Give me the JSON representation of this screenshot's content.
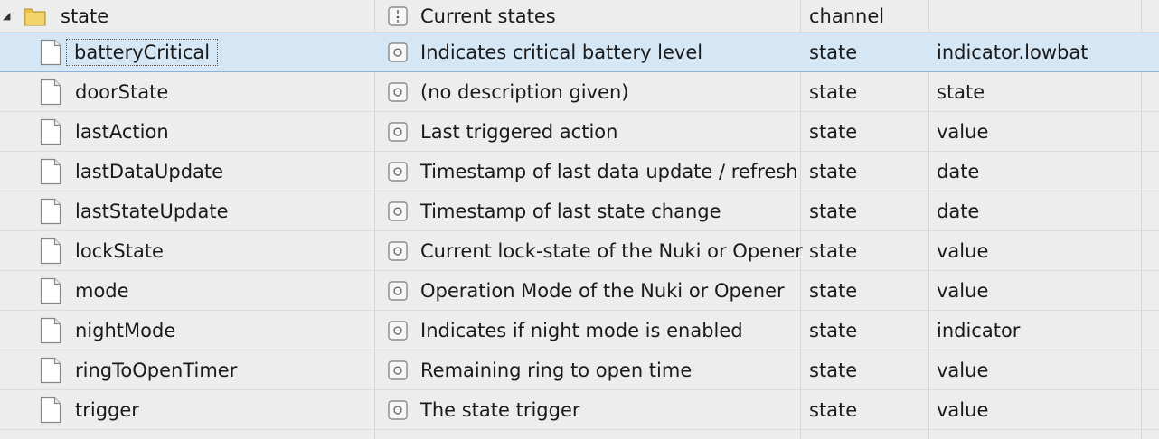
{
  "header": {
    "expander_icon": "triangle-down-icon",
    "name": "state",
    "description": "Current states",
    "type": "channel",
    "role": ""
  },
  "rows": [
    {
      "name": "batteryCritical",
      "description": "Indicates critical battery level",
      "type": "state",
      "role": "indicator.lowbat",
      "selected": true
    },
    {
      "name": "doorState",
      "description": "(no description given)",
      "type": "state",
      "role": "state"
    },
    {
      "name": "lastAction",
      "description": "Last triggered action",
      "type": "state",
      "role": "value"
    },
    {
      "name": "lastDataUpdate",
      "description": "Timestamp of last data update / refresh",
      "type": "state",
      "role": "date"
    },
    {
      "name": "lastStateUpdate",
      "description": "Timestamp of last state change",
      "type": "state",
      "role": "date"
    },
    {
      "name": "lockState",
      "description": "Current lock-state of the Nuki or Opener",
      "type": "state",
      "role": "value"
    },
    {
      "name": "mode",
      "description": "Operation Mode of the Nuki or Opener",
      "type": "state",
      "role": "value"
    },
    {
      "name": "nightMode",
      "description": "Indicates if night mode is enabled",
      "type": "state",
      "role": "indicator"
    },
    {
      "name": "ringToOpenTimer",
      "description": "Remaining ring to open time",
      "type": "state",
      "role": "value"
    },
    {
      "name": "trigger",
      "description": "The state trigger",
      "type": "state",
      "role": "value"
    }
  ],
  "colors": {
    "background": "#ededed",
    "selected_row": "#d5e6f5",
    "folder": "#e8c34a"
  }
}
